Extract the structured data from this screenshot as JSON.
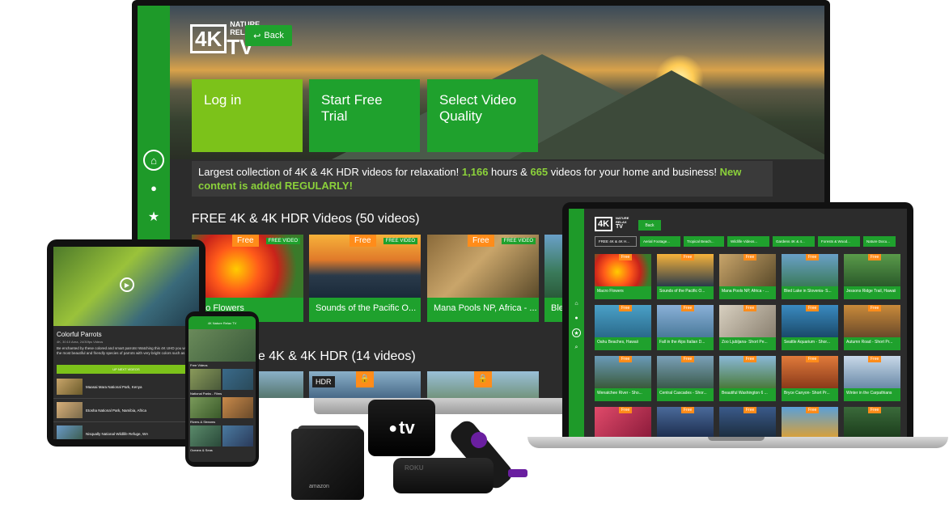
{
  "tv": {
    "logo": {
      "big": "4K",
      "line1": "NATURE",
      "line2": "RELAX",
      "tv": "TV"
    },
    "back_label": "Back",
    "tiles": [
      {
        "label": "Log in"
      },
      {
        "label": "Start Free Trial"
      },
      {
        "label": "Select Video Quality"
      }
    ],
    "banner": {
      "part1": "Largest collection of 4K & 4K HDR videos for relaxation! ",
      "hours": "1,166",
      "part2": " hours & ",
      "videos": "665",
      "part3": " videos for your home and business! ",
      "new_content": "New content is added REGULARLY!"
    },
    "section_free": "FREE 4K & 4K HDR Videos (50 videos)",
    "section_2": "ge 4K & 4K HDR (14 videos)",
    "free_badge": "Free",
    "video_badge": "FREE VIDEO",
    "hdr_badge": "HDR",
    "cards": [
      {
        "caption": "cro Flowers"
      },
      {
        "caption": "Sounds of the Pacific O..."
      },
      {
        "caption": "Mana Pools NP, Africa - ..."
      },
      {
        "caption": "Bled"
      }
    ]
  },
  "laptop": {
    "logo_big": "4K",
    "logo_small_1": "NATURE",
    "logo_small_2": "RELAX",
    "logo_small_3": "TV",
    "back_label": "Back",
    "chips": [
      "FREE 4K & 4K H...",
      "Aerial Footage...",
      "Tropical Beach...",
      "Wildlife Videos...",
      "Gardens 4K & 4...",
      "Forests & Wood...",
      "Nature Docu..."
    ],
    "free_badge": "Free",
    "cards": [
      "Macro Flowers",
      "Sounds of the Pacific O...",
      "Mana Pools NP, Africa - ...",
      "Bled Lake in Slovenia- S...",
      "Jessons Ridge Trail, Hawaii",
      "Oahu Beaches, Hawaii",
      "Fall in the Alps Italian D...",
      "Zoo Ljubljana- Short Pe...",
      "Seattle Aquarium - Shor...",
      "Autumn Road - Short Pr...",
      "Wenatchee River - Sho...",
      "Central Cascades - Shor...",
      "Beautiful Washington 6 ...",
      "Bryce Canyon- Short Pr...",
      "Winter in the Carpathians",
      "",
      "",
      "",
      "",
      ""
    ]
  },
  "tablet": {
    "title": "Colorful Parrots",
    "meta": "4K, 30:10 Area, 24/30fps Videos",
    "description": "Be enchanted by these colored and smart parrots! Watching this 4K UHD you will see the most beautiful and friendly species of parrots with very bright colors such as Ara...",
    "up_next": "UP NEXT VIDEOS",
    "items": [
      "Maasai Mara National Park, Kenya",
      "Etosha National Park, Namibia, Africa",
      "Nisqually National Wildlife Refuge, WA"
    ]
  },
  "phone": {
    "header": "4K Nature Relax TV",
    "sections": [
      "Free Videos",
      "National Parks - Films",
      "Rivers & Streams",
      "Oceans & Seas"
    ]
  },
  "devices": {
    "firetv_label": "amazon",
    "appletv_label": "tv",
    "roku_label": "ROKU"
  }
}
